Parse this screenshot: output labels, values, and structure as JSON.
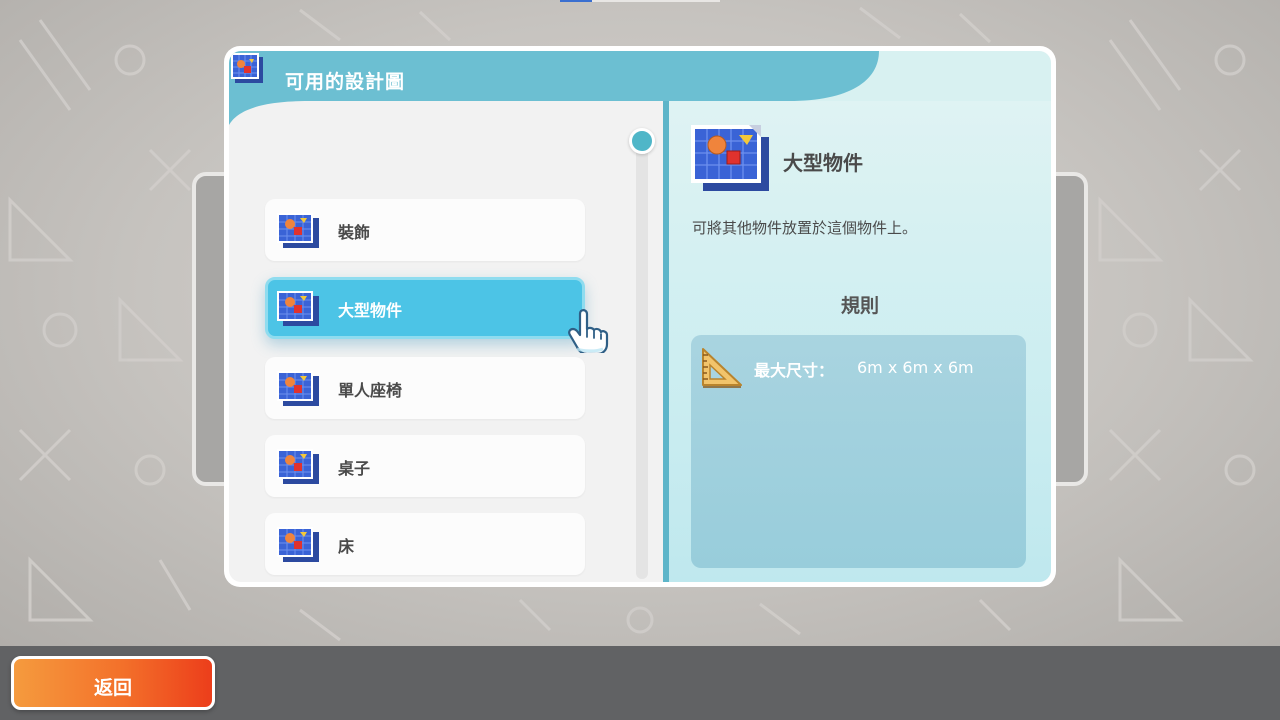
{
  "dialog": {
    "title": "可用的設計圖",
    "header_icon": "blueprint-icon"
  },
  "blueprint_list": {
    "items": [
      {
        "label": "裝飾",
        "selected": false
      },
      {
        "label": "大型物件",
        "selected": true
      },
      {
        "label": "單人座椅",
        "selected": false
      },
      {
        "label": "桌子",
        "selected": false
      },
      {
        "label": "床",
        "selected": false
      }
    ],
    "item_icon": "blueprint-icon",
    "cursor_icon": "pointing-hand-icon"
  },
  "detail": {
    "title": "大型物件",
    "description": "可將其他物件放置於這個物件上。",
    "rules_heading": "規則",
    "rules": [
      {
        "icon": "set-square-ruler-icon",
        "label": "最大尺寸：",
        "value": "6m x 6m x 6m"
      }
    ]
  },
  "footer": {
    "back_label": "返回"
  },
  "colors": {
    "header_teal": "#6cbfd2",
    "selected_item": "#4cc4e6",
    "back_button_start": "#f59b3e",
    "back_button_end": "#ec3e1b",
    "divider": "#5db5c9"
  }
}
